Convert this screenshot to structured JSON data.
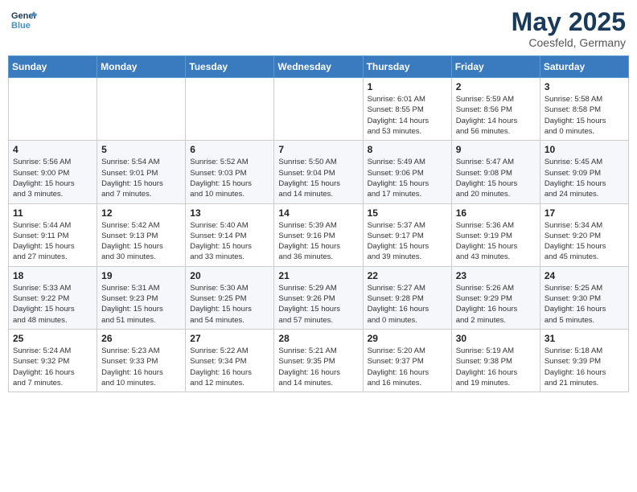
{
  "header": {
    "logo_line1": "General",
    "logo_line2": "Blue",
    "month_title": "May 2025",
    "location": "Coesfeld, Germany"
  },
  "days_of_week": [
    "Sunday",
    "Monday",
    "Tuesday",
    "Wednesday",
    "Thursday",
    "Friday",
    "Saturday"
  ],
  "weeks": [
    [
      {
        "day": "",
        "info": ""
      },
      {
        "day": "",
        "info": ""
      },
      {
        "day": "",
        "info": ""
      },
      {
        "day": "",
        "info": ""
      },
      {
        "day": "1",
        "info": "Sunrise: 6:01 AM\nSunset: 8:55 PM\nDaylight: 14 hours\nand 53 minutes."
      },
      {
        "day": "2",
        "info": "Sunrise: 5:59 AM\nSunset: 8:56 PM\nDaylight: 14 hours\nand 56 minutes."
      },
      {
        "day": "3",
        "info": "Sunrise: 5:58 AM\nSunset: 8:58 PM\nDaylight: 15 hours\nand 0 minutes."
      }
    ],
    [
      {
        "day": "4",
        "info": "Sunrise: 5:56 AM\nSunset: 9:00 PM\nDaylight: 15 hours\nand 3 minutes."
      },
      {
        "day": "5",
        "info": "Sunrise: 5:54 AM\nSunset: 9:01 PM\nDaylight: 15 hours\nand 7 minutes."
      },
      {
        "day": "6",
        "info": "Sunrise: 5:52 AM\nSunset: 9:03 PM\nDaylight: 15 hours\nand 10 minutes."
      },
      {
        "day": "7",
        "info": "Sunrise: 5:50 AM\nSunset: 9:04 PM\nDaylight: 15 hours\nand 14 minutes."
      },
      {
        "day": "8",
        "info": "Sunrise: 5:49 AM\nSunset: 9:06 PM\nDaylight: 15 hours\nand 17 minutes."
      },
      {
        "day": "9",
        "info": "Sunrise: 5:47 AM\nSunset: 9:08 PM\nDaylight: 15 hours\nand 20 minutes."
      },
      {
        "day": "10",
        "info": "Sunrise: 5:45 AM\nSunset: 9:09 PM\nDaylight: 15 hours\nand 24 minutes."
      }
    ],
    [
      {
        "day": "11",
        "info": "Sunrise: 5:44 AM\nSunset: 9:11 PM\nDaylight: 15 hours\nand 27 minutes."
      },
      {
        "day": "12",
        "info": "Sunrise: 5:42 AM\nSunset: 9:13 PM\nDaylight: 15 hours\nand 30 minutes."
      },
      {
        "day": "13",
        "info": "Sunrise: 5:40 AM\nSunset: 9:14 PM\nDaylight: 15 hours\nand 33 minutes."
      },
      {
        "day": "14",
        "info": "Sunrise: 5:39 AM\nSunset: 9:16 PM\nDaylight: 15 hours\nand 36 minutes."
      },
      {
        "day": "15",
        "info": "Sunrise: 5:37 AM\nSunset: 9:17 PM\nDaylight: 15 hours\nand 39 minutes."
      },
      {
        "day": "16",
        "info": "Sunrise: 5:36 AM\nSunset: 9:19 PM\nDaylight: 15 hours\nand 43 minutes."
      },
      {
        "day": "17",
        "info": "Sunrise: 5:34 AM\nSunset: 9:20 PM\nDaylight: 15 hours\nand 45 minutes."
      }
    ],
    [
      {
        "day": "18",
        "info": "Sunrise: 5:33 AM\nSunset: 9:22 PM\nDaylight: 15 hours\nand 48 minutes."
      },
      {
        "day": "19",
        "info": "Sunrise: 5:31 AM\nSunset: 9:23 PM\nDaylight: 15 hours\nand 51 minutes."
      },
      {
        "day": "20",
        "info": "Sunrise: 5:30 AM\nSunset: 9:25 PM\nDaylight: 15 hours\nand 54 minutes."
      },
      {
        "day": "21",
        "info": "Sunrise: 5:29 AM\nSunset: 9:26 PM\nDaylight: 15 hours\nand 57 minutes."
      },
      {
        "day": "22",
        "info": "Sunrise: 5:27 AM\nSunset: 9:28 PM\nDaylight: 16 hours\nand 0 minutes."
      },
      {
        "day": "23",
        "info": "Sunrise: 5:26 AM\nSunset: 9:29 PM\nDaylight: 16 hours\nand 2 minutes."
      },
      {
        "day": "24",
        "info": "Sunrise: 5:25 AM\nSunset: 9:30 PM\nDaylight: 16 hours\nand 5 minutes."
      }
    ],
    [
      {
        "day": "25",
        "info": "Sunrise: 5:24 AM\nSunset: 9:32 PM\nDaylight: 16 hours\nand 7 minutes."
      },
      {
        "day": "26",
        "info": "Sunrise: 5:23 AM\nSunset: 9:33 PM\nDaylight: 16 hours\nand 10 minutes."
      },
      {
        "day": "27",
        "info": "Sunrise: 5:22 AM\nSunset: 9:34 PM\nDaylight: 16 hours\nand 12 minutes."
      },
      {
        "day": "28",
        "info": "Sunrise: 5:21 AM\nSunset: 9:35 PM\nDaylight: 16 hours\nand 14 minutes."
      },
      {
        "day": "29",
        "info": "Sunrise: 5:20 AM\nSunset: 9:37 PM\nDaylight: 16 hours\nand 16 minutes."
      },
      {
        "day": "30",
        "info": "Sunrise: 5:19 AM\nSunset: 9:38 PM\nDaylight: 16 hours\nand 19 minutes."
      },
      {
        "day": "31",
        "info": "Sunrise: 5:18 AM\nSunset: 9:39 PM\nDaylight: 16 hours\nand 21 minutes."
      }
    ]
  ]
}
